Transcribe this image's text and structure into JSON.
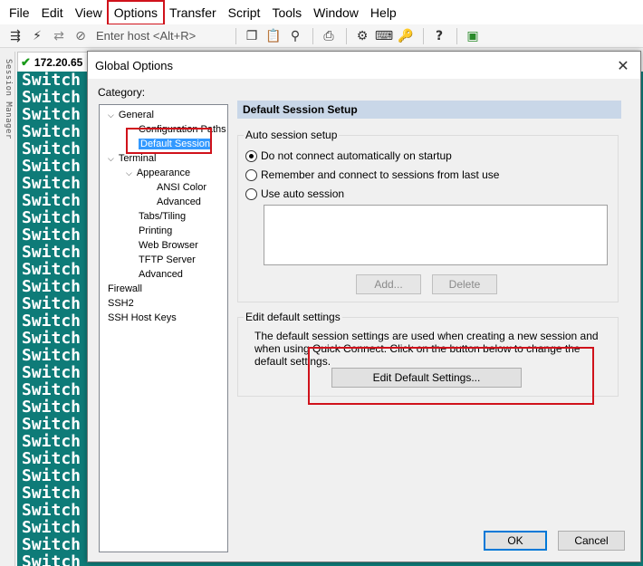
{
  "menubar": [
    "File",
    "Edit",
    "View",
    "Options",
    "Transfer",
    "Script",
    "Tools",
    "Window",
    "Help"
  ],
  "toolbar": {
    "host_placeholder": "Enter host <Alt+R>"
  },
  "session_rail_label": "Session Manager",
  "tab": {
    "label": "172.20.65"
  },
  "terminal": {
    "line_text": "Switch",
    "line_count": 29
  },
  "dialog": {
    "title": "Global Options",
    "category_label": "Category:",
    "tree": [
      {
        "label": "General",
        "expanded": true,
        "depth": 0
      },
      {
        "label": "Configuration Paths",
        "depth": 1
      },
      {
        "label": "Default Session",
        "depth": 1,
        "selected": true
      },
      {
        "label": "Terminal",
        "expanded": true,
        "depth": 0
      },
      {
        "label": "Appearance",
        "expanded": true,
        "depth": 1
      },
      {
        "label": "ANSI Color",
        "depth": 2
      },
      {
        "label": "Advanced",
        "depth": 2
      },
      {
        "label": "Tabs/Tiling",
        "depth": 1
      },
      {
        "label": "Printing",
        "depth": 1
      },
      {
        "label": "Web Browser",
        "depth": 1
      },
      {
        "label": "TFTP Server",
        "depth": 1
      },
      {
        "label": "Advanced",
        "depth": 1
      },
      {
        "label": "Firewall",
        "depth": 0
      },
      {
        "label": "SSH2",
        "depth": 0
      },
      {
        "label": "SSH Host Keys",
        "depth": 0
      }
    ],
    "pane_title": "Default Session Setup",
    "auto_session": {
      "title": "Auto session setup",
      "options": [
        {
          "label": "Do not connect automatically on startup",
          "checked": true
        },
        {
          "label": "Remember and connect to sessions from last use",
          "checked": false
        },
        {
          "label": "Use auto session",
          "checked": false
        }
      ],
      "add_label": "Add...",
      "delete_label": "Delete"
    },
    "edit_defaults": {
      "title": "Edit default settings",
      "description": "The default session settings are used when creating a new session and when using Quick Connect.  Click on the button below to change the default settings.",
      "button_label": "Edit Default Settings..."
    },
    "ok_label": "OK",
    "cancel_label": "Cancel"
  },
  "colors": {
    "terminal_bg": "#0e7b78",
    "highlight_red": "#d0121b",
    "selection_blue": "#3399ff"
  }
}
